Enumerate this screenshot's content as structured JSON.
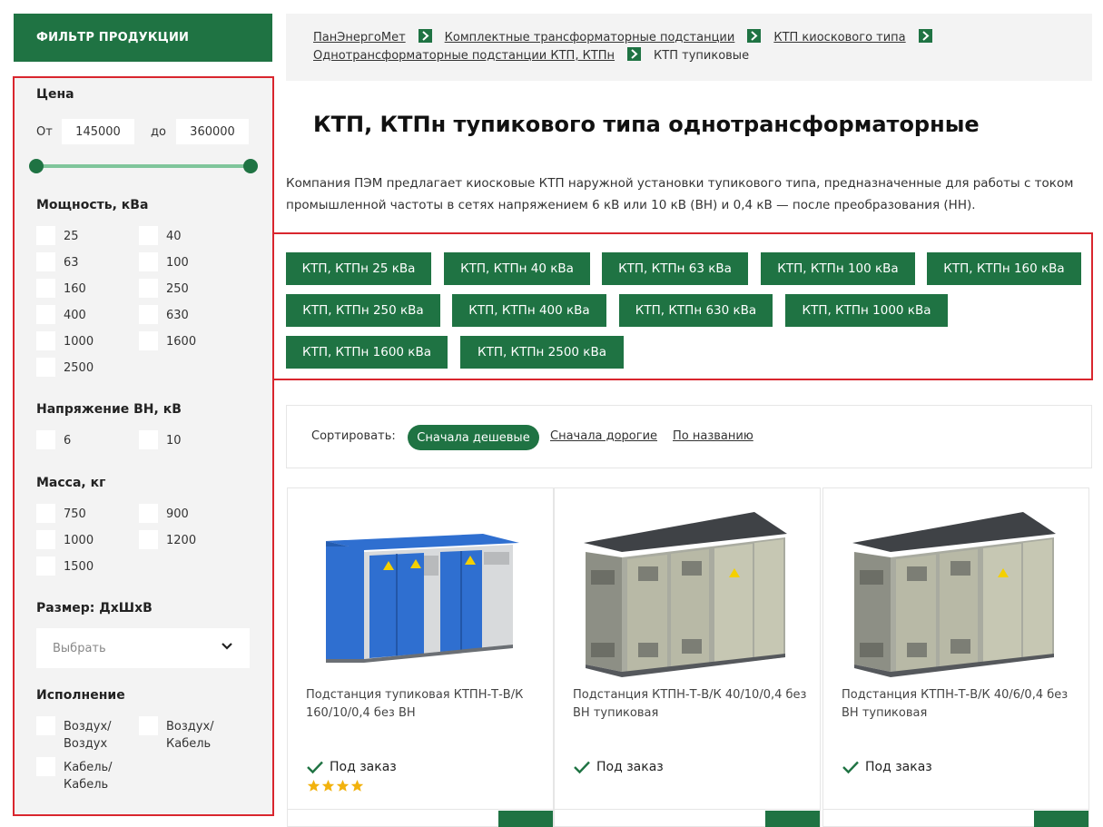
{
  "sidebar": {
    "header": "ФИЛЬТР ПРОДУКЦИИ",
    "price": {
      "title": "Цена",
      "from_label": "От",
      "from_value": "145000",
      "to_label": "до",
      "to_value": "360000"
    },
    "power": {
      "title": "Мощность, кВа",
      "options": [
        "25",
        "40",
        "63",
        "100",
        "160",
        "250",
        "400",
        "630",
        "1000",
        "1600",
        "2500"
      ]
    },
    "voltage": {
      "title": "Напряжение ВН, кВ",
      "options": [
        "6",
        "10"
      ]
    },
    "mass": {
      "title": "Масса, кг",
      "options": [
        "750",
        "900",
        "1000",
        "1200",
        "1500"
      ]
    },
    "size": {
      "title": "Размер: ДхШхВ",
      "placeholder": "Выбрать"
    },
    "execution": {
      "title": "Исполнение",
      "options": [
        "Воздух/ Воздух",
        "Воздух/ Кабель",
        "Кабель/ Кабель"
      ]
    }
  },
  "breadcrumb": {
    "items": [
      "ПанЭнергоМет",
      "Комплектные трансформаторные подстанции",
      "КТП киоскового типа",
      "Однотрансформаторные подстанции КТП, КТПн"
    ],
    "current": "КТП тупиковые"
  },
  "page": {
    "title": "КТП, КТПн тупикового типа однотрансформаторные",
    "description": "Компания ПЭМ предлагает киосковые КТП наружной установки тупикового типа, предназначенные для работы с током промышленной частоты в сетях напряжением 6 кВ или 10 кВ (ВН) и 0,4 кВ — после преобразования (НН)."
  },
  "categories": [
    "КТП, КТПн 25 кВа",
    "КТП, КТПн 40 кВа",
    "КТП, КТПн 63 кВа",
    "КТП, КТПн 100 кВа",
    "КТП, КТПн 160 кВа",
    "КТП, КТПн 250 кВа",
    "КТП, КТПн 400 кВа",
    "КТП, КТПн 630 кВа",
    "КТП, КТПн 1000 кВа",
    "КТП, КТПн 1600 кВа",
    "КТП, КТПн 2500 кВа"
  ],
  "sort": {
    "label": "Сортировать:",
    "active": "Сначала дешевые",
    "option_expensive": "Сначала дорогие",
    "option_name": "По названию"
  },
  "products": [
    {
      "title": "Подстанция тупиковая КТПН-Т-В/К 160/10/0,4 без ВН",
      "status": "Под заказ",
      "rating": 4,
      "color": "#2f6fd0"
    },
    {
      "title": "Подстанция КТПН-Т-В/К 40/10/0,4 без ВН тупиковая",
      "status": "Под заказ",
      "color": "#b8b9a6"
    },
    {
      "title": "Подстанция КТПН-Т-В/К 40/6/0,4 без ВН тупиковая",
      "status": "Под заказ",
      "color": "#b8b9a6"
    }
  ],
  "colors": {
    "brand_green": "#1f7343",
    "highlight_red": "#d9262e",
    "star_gold": "#f2b20d"
  }
}
